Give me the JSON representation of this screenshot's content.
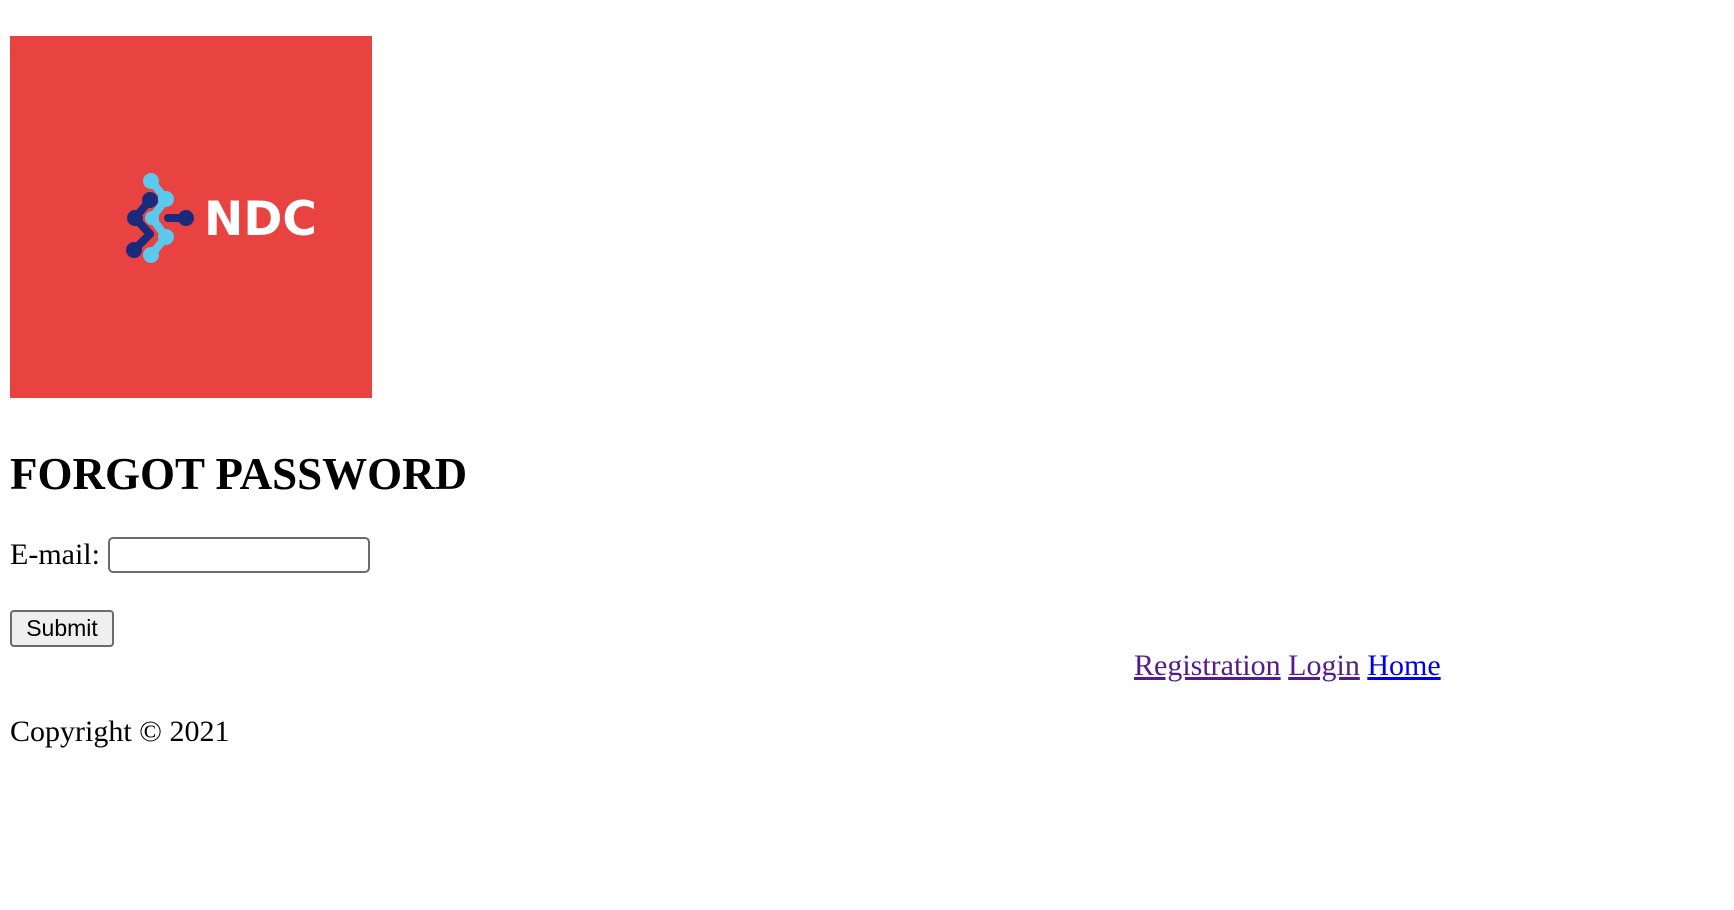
{
  "logo": {
    "brand_text": "NDC",
    "background_color": "#E84340",
    "dot_dark_color": "#1B2A7A",
    "dot_light_color": "#5BC8EE",
    "icon": "ndc-molecule-logo-icon"
  },
  "page": {
    "title": "FORGOT PASSWORD"
  },
  "form": {
    "email_label": "E-mail:",
    "email_value": "",
    "email_placeholder": "",
    "submit_label": "Submit"
  },
  "nav": {
    "registration_label": "Registration",
    "login_label": "Login",
    "home_label": "Home",
    "visited_link_color": "#551A8B",
    "link_color": "#0000EE"
  },
  "footer": {
    "copyright": "Copyright © 2021"
  }
}
